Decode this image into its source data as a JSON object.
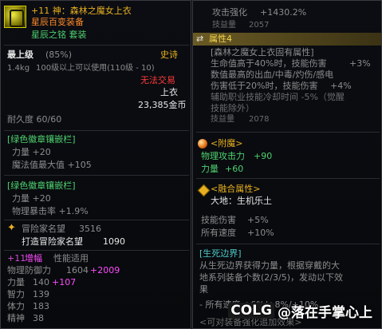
{
  "left": {
    "header": {
      "title": "+11 神：森林之魔女上衣",
      "subtitle": "星辰百变装备",
      "set_name": "星辰之铭 套装"
    },
    "level_label": "最上级",
    "level_pct": "(85%)",
    "rarity": "史诗",
    "weight": "1.4kg",
    "req": "100级以上可以使用(110级 - 10)",
    "trade": "无法交易",
    "slot": "上衣",
    "price": "23,385金币",
    "durability": "耐久度 60/60",
    "emblem1": {
      "title": "[绿色徽章镶嵌栏]",
      "line1": "力量 +20",
      "line2": "魔法值最大值 +105"
    },
    "emblem2": {
      "title": "[绿色徽章镶嵌栏]",
      "line1": "力量 +20",
      "line2": "物理暴击率 +1.9%"
    },
    "fame": {
      "label": "冒险家名望",
      "value": "3516",
      "label2": "打造冒险家名望",
      "value2": "1090"
    },
    "amp": {
      "prefix": "+11",
      "name": "增幅",
      "type": "性能适用",
      "def_label": "物理防御力",
      "def_base": "1604",
      "def_add": "+2009",
      "str_label": "力量",
      "str_base": "140",
      "str_add": "+107",
      "rows": [
        "智力",
        "体力",
        "精神"
      ],
      "row_vals": [
        "139",
        "183",
        "38"
      ],
      "row_adds": [
        "",
        "",
        ""
      ]
    }
  },
  "right": {
    "attack_label": "攻击强化",
    "attack_value": "+1430.2%",
    "gain_label1": "技益量",
    "gain_value1": "2057",
    "attr4": "属性4",
    "set_attr_title": "[森林之魔女上衣固有属性]",
    "lines": [
      {
        "text": "生命值高于40%时，技能伤害",
        "val": "+3%"
      },
      {
        "text": "数值最高的出血/中毒/灼伤/感电",
        "val": ""
      },
      {
        "text": "伤害低于20%时，技能伤害",
        "val": "+4%"
      },
      {
        "text": "辅助职业技能冷却时间 -5%（觉醒",
        "val": ""
      },
      {
        "text": "技能除外）",
        "val": ""
      }
    ],
    "gain_label2": "技益量",
    "gain_value2": "2078",
    "enchant_title": "<附魔>",
    "enchant_line1_label": "物理攻击力",
    "enchant_line1_val": "+90",
    "enchant_line2_label": "力量",
    "enchant_line2_val": "+60",
    "fusion_title": "<融合属性>",
    "fusion_sub": "大地：生机乐土",
    "skill_dmg_label": "技能伤害",
    "skill_dmg_val": "+5%",
    "speed_label": "所有速度",
    "speed_val": "+10%",
    "border_title": "[生死边界]",
    "border_desc1": "从生死边界获得力量，根据穿戴的大",
    "border_desc2": "地系列装备个数(2/3/5)，发动以下效",
    "border_desc3": "果",
    "border_line4": "- 所有速度 +6%/+8%/+10%",
    "border_line5": "<可对装备强化追加效果>"
  },
  "watermark": {
    "logo": "COLG",
    "text": "@落在手掌心上"
  },
  "colors": {
    "gold": "#e8b020",
    "orange": "#ff8a2a",
    "green": "#4fd16f",
    "cyan": "#4fc9c9",
    "red": "#ff3a3a",
    "magenta": "#ff4cff"
  }
}
